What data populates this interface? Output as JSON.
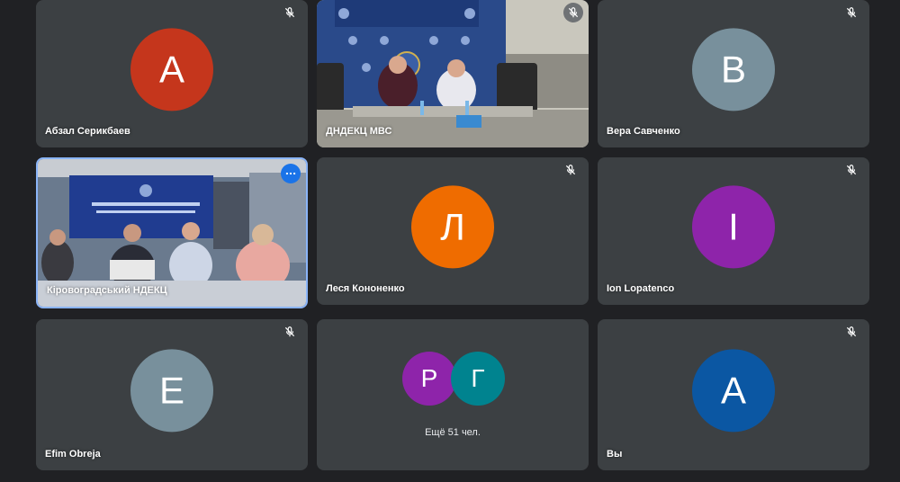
{
  "tiles": [
    {
      "name": "Абзал Серикбаев",
      "initial": "А",
      "color": "#c5361c",
      "muted": true
    },
    {
      "name": "ДНДЕКЦ МВС",
      "muted": true,
      "video": true
    },
    {
      "name": "Вера Савченко",
      "initial": "В",
      "color": "#78909c",
      "muted": true
    },
    {
      "name": "Кіровоградський НДЕКЦ",
      "video": true,
      "active": true
    },
    {
      "name": "Леся Кононенко",
      "initial": "Л",
      "color": "#ef6c00",
      "muted": true
    },
    {
      "name": "Ion Lopatenco",
      "initial": "I",
      "color": "#8e24aa",
      "muted": true
    },
    {
      "name": "Efim Obreja",
      "initial": "E",
      "color": "#78909c",
      "muted": true
    },
    {
      "group": true,
      "initials": [
        "Р",
        "Г"
      ],
      "colors": [
        "#8e24aa",
        "#00838f"
      ],
      "label": "Ещё 51 чел."
    },
    {
      "name": "Вы",
      "initial": "А",
      "color": "#0b57a3",
      "muted": true
    }
  ]
}
